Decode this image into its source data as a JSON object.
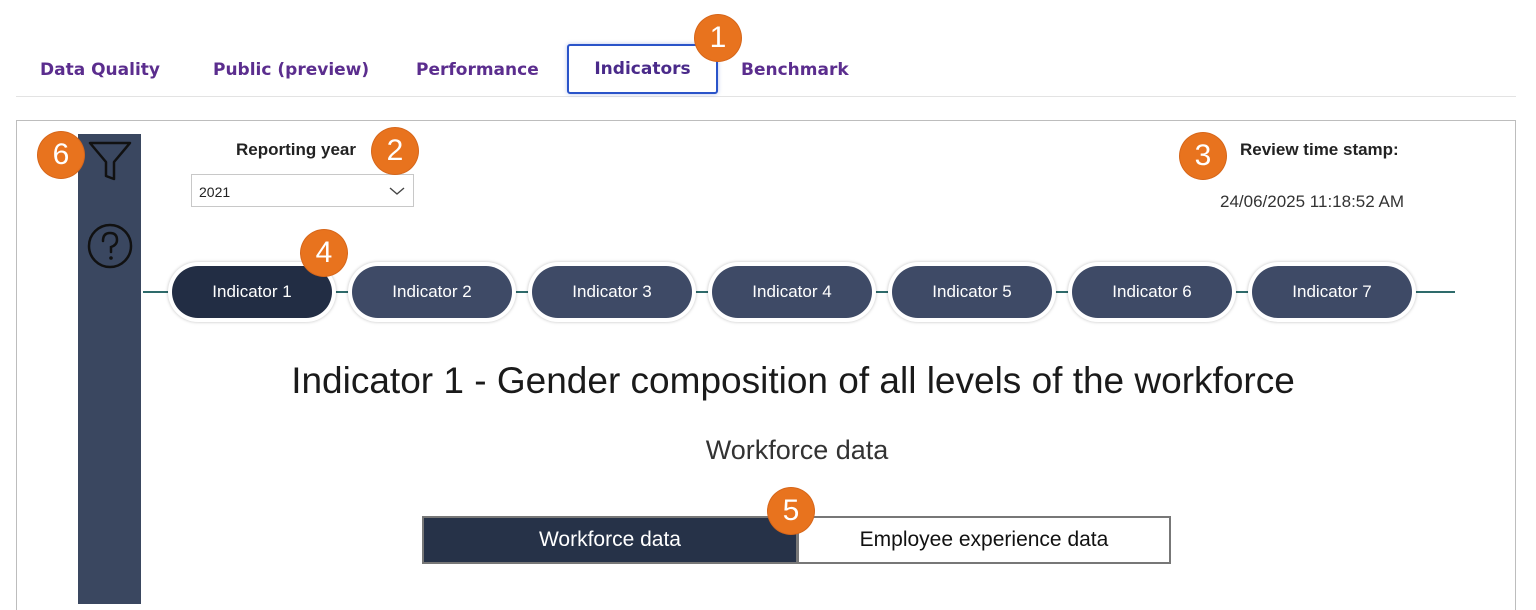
{
  "tabs": [
    {
      "label": "Data Quality"
    },
    {
      "label": "Public (preview)"
    },
    {
      "label": "Performance"
    },
    {
      "label": "Indicators",
      "active": true
    },
    {
      "label": "Benchmark"
    }
  ],
  "filters": {
    "reporting_year_label": "Reporting year",
    "reporting_year_value": "2021"
  },
  "review": {
    "label": "Review time stamp:",
    "value": "24/06/2025 11:18:52 AM"
  },
  "indicators": [
    "Indicator 1",
    "Indicator 2",
    "Indicator 3",
    "Indicator 4",
    "Indicator 5",
    "Indicator 6",
    "Indicator 7"
  ],
  "active_indicator": 0,
  "main": {
    "title": "Indicator 1 - Gender composition of all levels of the workforce",
    "subtitle": "Workforce data"
  },
  "toggle": {
    "workforce": "Workforce data",
    "experience": "Employee experience data"
  },
  "callouts": [
    "1",
    "2",
    "3",
    "4",
    "5",
    "6"
  ],
  "colors": {
    "tab_text": "#5b2d8e",
    "sidebar": "#3a4760",
    "pill": "#3e4a66",
    "pill_active": "#222d44",
    "callout": "#e8731e"
  },
  "icons": [
    "filter-icon",
    "help-icon",
    "chevron-down-icon"
  ]
}
